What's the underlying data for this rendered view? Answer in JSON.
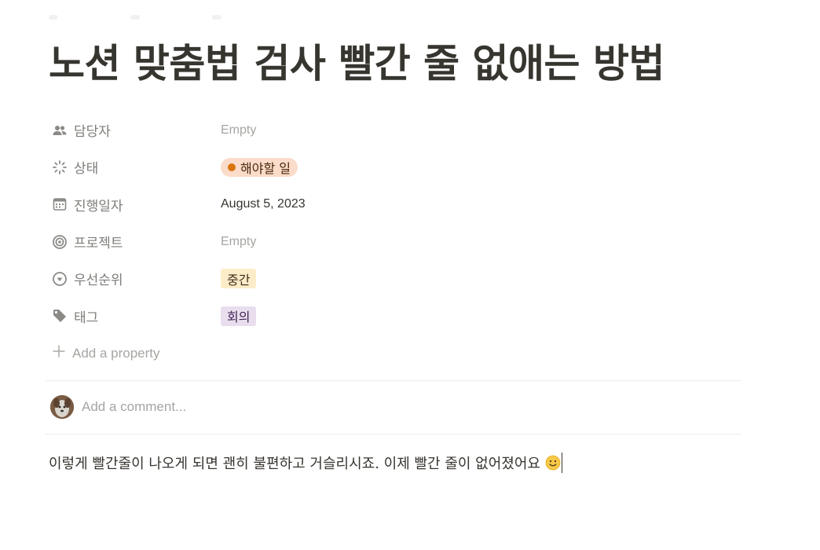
{
  "page": {
    "title": "노션 맞춤법 검사 빨간 줄 없애는 방법"
  },
  "properties": [
    {
      "name": "담당자",
      "icon": "people-icon",
      "value": "Empty",
      "type": "empty"
    },
    {
      "name": "상태",
      "icon": "status-icon",
      "value": "해야할 일",
      "type": "status",
      "color": "#d9730d"
    },
    {
      "name": "진행일자",
      "icon": "calendar-icon",
      "value": "August 5, 2023",
      "type": "date"
    },
    {
      "name": "프로젝트",
      "icon": "target-icon",
      "value": "Empty",
      "type": "empty"
    },
    {
      "name": "우선순위",
      "icon": "chevron-circle-icon",
      "value": "중간",
      "type": "select",
      "color": "#fdecc8"
    },
    {
      "name": "태그",
      "icon": "tag-icon",
      "value": "회의",
      "type": "multi-select",
      "color": "#e8deee"
    }
  ],
  "add_property": {
    "label": "Add a property",
    "icon": "plus-icon"
  },
  "comment": {
    "placeholder": "Add a comment...",
    "avatar": "avatar"
  },
  "body": {
    "text": "이렇게 빨간줄이 나오게 되면 괜히 불편하고 거슬리시죠. 이제 빨간 줄이 없어졌어요",
    "emoji": "slightly-smiling-face-icon"
  }
}
